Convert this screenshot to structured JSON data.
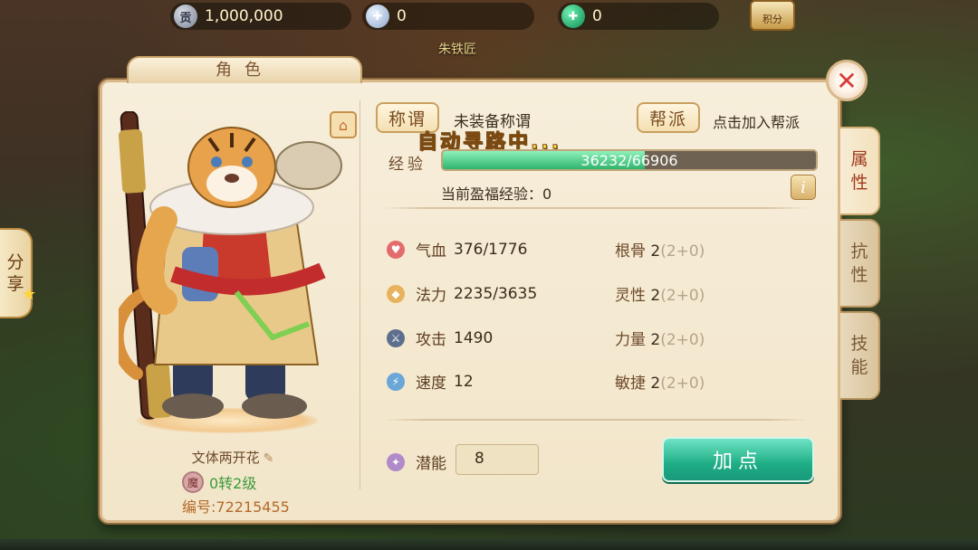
{
  "topbar": {
    "gold": {
      "icon": "gong-coin-icon",
      "icon_char": "贡",
      "value": "1,000,000"
    },
    "silver": {
      "icon": "silver-ingot-icon",
      "value": "0"
    },
    "jade": {
      "icon": "jade-coin-icon",
      "value": "0"
    },
    "score_label": "积分"
  },
  "npc_label": "朱铁匠",
  "share": {
    "line1": "分",
    "line2": "享"
  },
  "panel": {
    "title": "角色"
  },
  "character": {
    "name": "文体两开花",
    "race_badge": "魔",
    "level": "0转2级",
    "serial": "编号:72215455"
  },
  "title": {
    "button": "称谓",
    "value": "未装备称谓"
  },
  "gang": {
    "button": "帮派",
    "value": "点击加入帮派"
  },
  "auto_path": "自动寻路中...",
  "exp": {
    "label": "经验",
    "current": 36232,
    "max": 66906,
    "text": "36232/66906"
  },
  "bonus_exp": "当前盈福经验：0",
  "stats": {
    "hp": {
      "name": "气血",
      "value": "376/1776"
    },
    "mp": {
      "name": "法力",
      "value": "2235/3635"
    },
    "atk": {
      "name": "攻击",
      "value": "1490"
    },
    "spd": {
      "name": "速度",
      "value": "12"
    }
  },
  "attrs": [
    {
      "name": "根骨",
      "value": "2",
      "extra": "(2+0)"
    },
    {
      "name": "灵性",
      "value": "2",
      "extra": "(2+0)"
    },
    {
      "name": "力量",
      "value": "2",
      "extra": "(2+0)"
    },
    {
      "name": "敏捷",
      "value": "2",
      "extra": "(2+0)"
    }
  ],
  "potential": {
    "label": "潜能",
    "value": "8"
  },
  "add_points_label": "加点",
  "tabs": [
    {
      "l1": "属",
      "l2": "性",
      "active": true
    },
    {
      "l1": "抗",
      "l2": "性",
      "active": false
    },
    {
      "l1": "技",
      "l2": "能",
      "active": false
    }
  ],
  "colors": {
    "accent_green": "#1fae86",
    "exp_green": "#2fb46e",
    "tab_active_text": "#a0391d"
  }
}
